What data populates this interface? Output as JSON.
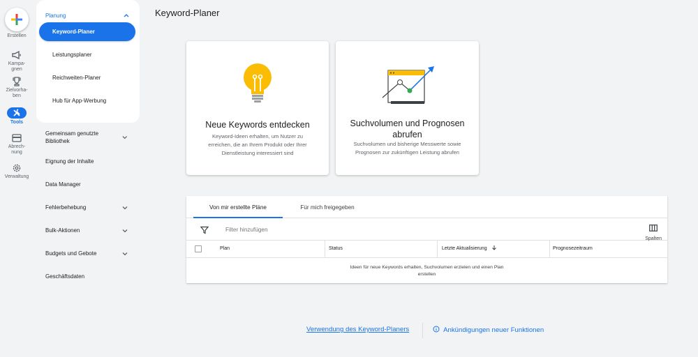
{
  "rail": {
    "create_label": "Erstellen",
    "items": [
      {
        "label": "Kampa-\ngnen",
        "icon": "megaphone-icon"
      },
      {
        "label": "Zielvorha-\nben",
        "icon": "trophy-icon"
      },
      {
        "label": "Tools",
        "icon": "tools-icon"
      },
      {
        "label": "Abrech-\nnung",
        "icon": "credit-card-icon"
      },
      {
        "label": "Verwaltung",
        "icon": "gear-icon"
      }
    ]
  },
  "nav": {
    "section": "Planung",
    "sub_items": [
      "Keyword-Planer",
      "Leistungsplaner",
      "Reichweiten-Planer",
      "Hub für App-Werbung"
    ],
    "groups": [
      {
        "label": "Gemeinsam genutzte Bibliothek",
        "expandable": true
      },
      {
        "label": "Eignung der Inhalte",
        "expandable": false
      },
      {
        "label": "Data Manager",
        "expandable": false
      },
      {
        "label": "Fehlerbehebung",
        "expandable": true
      },
      {
        "label": "Bulk-Aktionen",
        "expandable": true
      },
      {
        "label": "Budgets und Gebote",
        "expandable": true
      },
      {
        "label": "Geschäftsdaten",
        "expandable": false
      }
    ]
  },
  "main": {
    "title": "Keyword-Planer",
    "cards": [
      {
        "title": "Neue Keywords entdecken",
        "desc": "Keyword-Ideen erhalten, um Nutzer zu erreichen, die an Ihrem Produkt oder Ihrer Dienstleistung interessiert sind"
      },
      {
        "title": "Suchvolumen und Prognosen abrufen",
        "desc": "Suchvolumen und bisherige Messwerte sowie Prognosen zur zukünftigen Leistung abrufen"
      }
    ]
  },
  "plans": {
    "tabs": [
      "Von mir erstellte Pläne",
      "Für mich freigegeben"
    ],
    "filter_placeholder": "Filter hinzufügen",
    "columns_label": "Spalten",
    "headers": [
      "Plan",
      "Status",
      "Letzte Aktualisierung",
      "Prognosezeitraum"
    ],
    "empty_text": "Ideen für neue Keywords erhalten, Suchvolumen erzielen und einen Plan erstellen"
  },
  "footer": {
    "link_usage": "Verwendung des Keyword-Planers",
    "link_announcements": "Ankündigungen neuer Funktionen"
  },
  "colors": {
    "accent": "#1a73e8",
    "bulb": "#fbbc04",
    "chart_green": "#34a853"
  }
}
